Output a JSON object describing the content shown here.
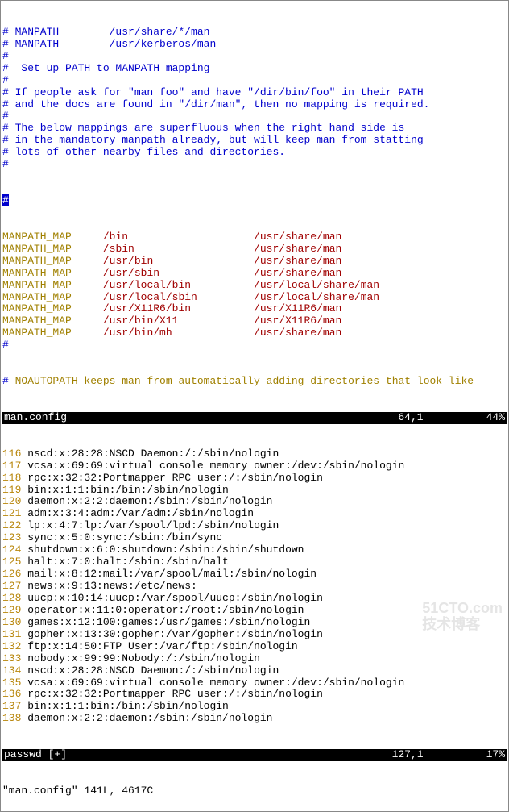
{
  "top_comment": [
    "# MANPATH        /usr/share/*/man",
    "# MANPATH        /usr/kerberos/man",
    "#",
    "#  Set up PATH to MANPATH mapping",
    "#",
    "# If people ask for \"man foo\" and have \"/dir/bin/foo\" in their PATH",
    "# and the docs are found in \"/dir/man\", then no mapping is required.",
    "#",
    "# The below mappings are superfluous when the right hand side is",
    "# in the mandatory manpath already, but will keep man from statting",
    "# lots of other nearby files and directories.",
    "#"
  ],
  "mappings": [
    {
      "key": "MANPATH_MAP",
      "path": "/bin",
      "target": "/usr/share/man"
    },
    {
      "key": "MANPATH_MAP",
      "path": "/sbin",
      "target": "/usr/share/man"
    },
    {
      "key": "MANPATH_MAP",
      "path": "/usr/bin",
      "target": "/usr/share/man"
    },
    {
      "key": "MANPATH_MAP",
      "path": "/usr/sbin",
      "target": "/usr/share/man"
    },
    {
      "key": "MANPATH_MAP",
      "path": "/usr/local/bin",
      "target": "/usr/local/share/man"
    },
    {
      "key": "MANPATH_MAP",
      "path": "/usr/local/sbin",
      "target": "/usr/local/share/man"
    },
    {
      "key": "MANPATH_MAP",
      "path": "/usr/X11R6/bin",
      "target": "/usr/X11R6/man"
    },
    {
      "key": "MANPATH_MAP",
      "path": "/usr/bin/X11",
      "target": "/usr/X11R6/man"
    },
    {
      "key": "MANPATH_MAP",
      "path": "/usr/bin/mh",
      "target": "/usr/share/man"
    }
  ],
  "noautopath": {
    "hash": "#",
    "text": " NOAUTOPATH keeps man from automatically adding directories that look like"
  },
  "status_top": {
    "file": "man.config",
    "pos": "64,1",
    "pct": "44%"
  },
  "passwd_lines": [
    {
      "n": "116",
      "t": "nscd:x:28:28:NSCD Daemon:/:/sbin/nologin"
    },
    {
      "n": "117",
      "t": "vcsa:x:69:69:virtual console memory owner:/dev:/sbin/nologin"
    },
    {
      "n": "118",
      "t": "rpc:x:32:32:Portmapper RPC user:/:/sbin/nologin"
    },
    {
      "n": "119",
      "t": "bin:x:1:1:bin:/bin:/sbin/nologin"
    },
    {
      "n": "120",
      "t": "daemon:x:2:2:daemon:/sbin:/sbin/nologin"
    },
    {
      "n": "121",
      "t": "adm:x:3:4:adm:/var/adm:/sbin/nologin"
    },
    {
      "n": "122",
      "t": "lp:x:4:7:lp:/var/spool/lpd:/sbin/nologin"
    },
    {
      "n": "123",
      "t": "sync:x:5:0:sync:/sbin:/bin/sync"
    },
    {
      "n": "124",
      "t": "shutdown:x:6:0:shutdown:/sbin:/sbin/shutdown"
    },
    {
      "n": "125",
      "t": "halt:x:7:0:halt:/sbin:/sbin/halt"
    },
    {
      "n": "126",
      "t": "mail:x:8:12:mail:/var/spool/mail:/sbin/nologin"
    },
    {
      "n": "127",
      "t": "news:x:9:13:news:/etc/news:"
    },
    {
      "n": "128",
      "t": "uucp:x:10:14:uucp:/var/spool/uucp:/sbin/nologin"
    },
    {
      "n": "129",
      "t": "operator:x:11:0:operator:/root:/sbin/nologin"
    },
    {
      "n": "130",
      "t": "games:x:12:100:games:/usr/games:/sbin/nologin"
    },
    {
      "n": "131",
      "t": "gopher:x:13:30:gopher:/var/gopher:/sbin/nologin"
    },
    {
      "n": "132",
      "t": "ftp:x:14:50:FTP User:/var/ftp:/sbin/nologin"
    },
    {
      "n": "133",
      "t": "nobody:x:99:99:Nobody:/:/sbin/nologin"
    },
    {
      "n": "134",
      "t": "nscd:x:28:28:NSCD Daemon:/:/sbin/nologin"
    },
    {
      "n": "135",
      "t": "vcsa:x:69:69:virtual console memory owner:/dev:/sbin/nologin"
    },
    {
      "n": "136",
      "t": "rpc:x:32:32:Portmapper RPC user:/:/sbin/nologin"
    },
    {
      "n": "137",
      "t": "bin:x:1:1:bin:/bin:/sbin/nologin"
    },
    {
      "n": "138",
      "t": "daemon:x:2:2:daemon:/sbin:/sbin/nologin"
    }
  ],
  "status_bot": {
    "file": "passwd [+]",
    "pos": "127,1",
    "pct": "17%"
  },
  "cmdline": "\"man.config\" 141L, 4617C",
  "watermark": {
    "l1": "51CTO.com",
    "l2": "技术博客"
  }
}
